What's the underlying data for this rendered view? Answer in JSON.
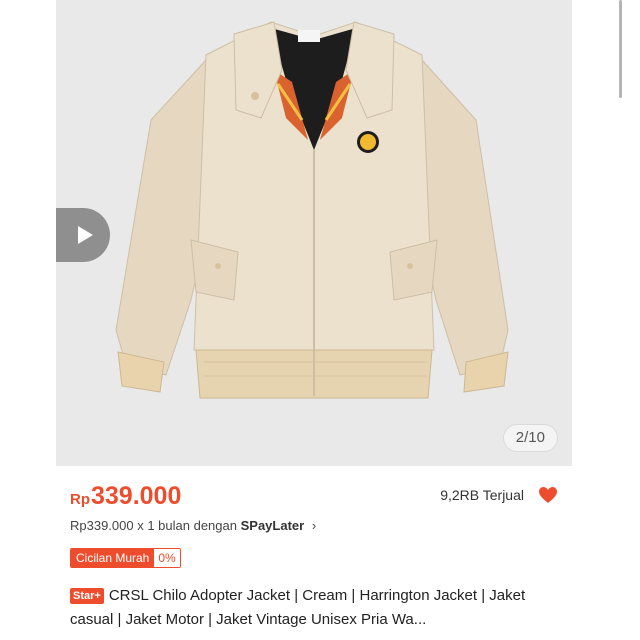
{
  "gallery": {
    "counter": "2/10",
    "play_icon": "play-icon"
  },
  "product": {
    "price_currency": "Rp",
    "price_value": "339.000",
    "sold": "9,2RB Terjual",
    "installment_prefix": "Rp339.000 x 1 bulan dengan",
    "installment_brand": "SPayLater",
    "installment_chevron": "›",
    "promo_label": "Cicilan Murah",
    "promo_rate": "0%",
    "star_tag": "Star+",
    "title": "CRSL Chilo Adopter Jacket | Cream | Harrington Jacket | Jaket casual | Jaket Motor | Jaket Vintage Unisex Pria Wa..."
  },
  "colors": {
    "accent": "#ee4d2d",
    "jacket": "#e9dcc6",
    "background": "#e9e9e9"
  }
}
